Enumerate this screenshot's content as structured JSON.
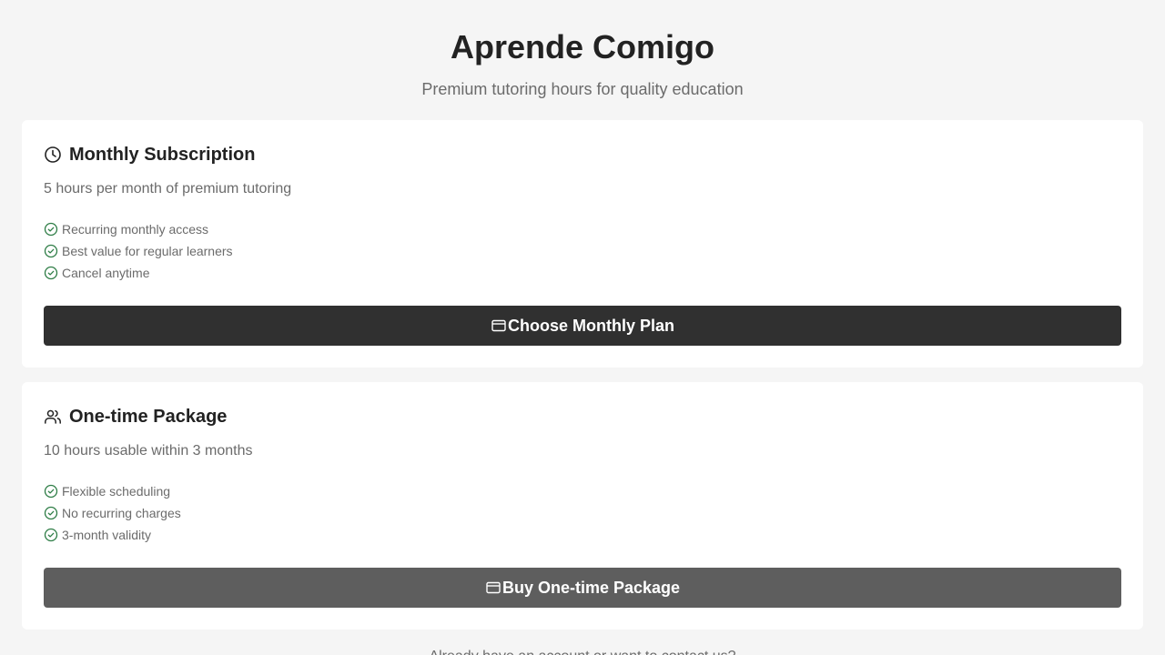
{
  "header": {
    "title": "Aprende Comigo",
    "subtitle": "Premium tutoring hours for quality education"
  },
  "plans": [
    {
      "icon": "clock-icon",
      "title": "Monthly Subscription",
      "description": "5 hours per month of premium tutoring",
      "features": [
        "Recurring monthly access",
        "Best value for regular learners",
        "Cancel anytime"
      ],
      "button_icon": "card-icon",
      "button_label": "Choose Monthly Plan",
      "button_color": "#303030"
    },
    {
      "icon": "users-icon",
      "title": "One-time Package",
      "description": "10 hours usable within 3 months",
      "features": [
        "Flexible scheduling",
        "No recurring charges",
        "3-month validity"
      ],
      "button_icon": "card-icon",
      "button_label": "Buy One-time Package",
      "button_color": "#5e5e5e"
    }
  ],
  "footer": {
    "text": "Already have an account or want to contact us?"
  },
  "colors": {
    "background": "#f5f5f5",
    "card": "#ffffff",
    "check": "#2e7d46",
    "text_muted": "#6b6b6b"
  }
}
